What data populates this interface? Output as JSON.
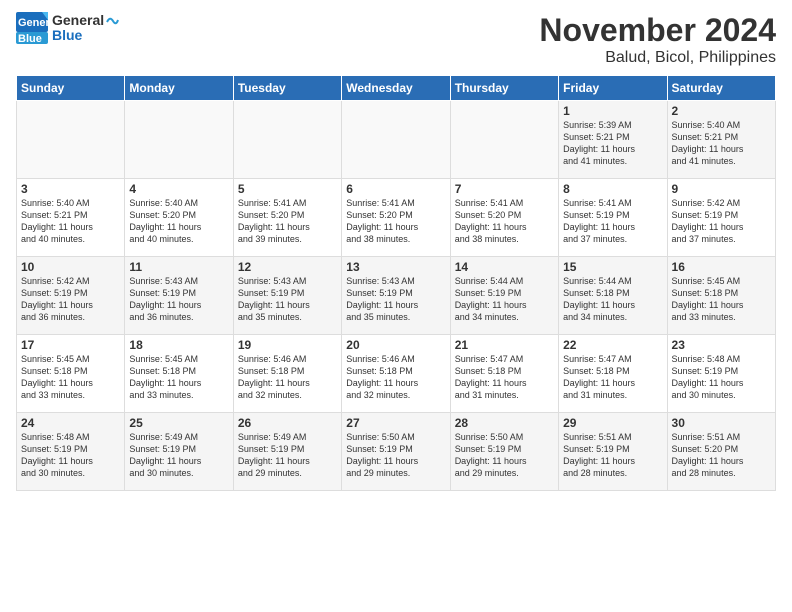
{
  "logo": {
    "text_general": "General",
    "text_blue": "Blue"
  },
  "title": {
    "month": "November 2024",
    "location": "Balud, Bicol, Philippines"
  },
  "weekdays": [
    "Sunday",
    "Monday",
    "Tuesday",
    "Wednesday",
    "Thursday",
    "Friday",
    "Saturday"
  ],
  "weeks": [
    [
      {
        "day": "",
        "info": ""
      },
      {
        "day": "",
        "info": ""
      },
      {
        "day": "",
        "info": ""
      },
      {
        "day": "",
        "info": ""
      },
      {
        "day": "",
        "info": ""
      },
      {
        "day": "1",
        "info": "Sunrise: 5:39 AM\nSunset: 5:21 PM\nDaylight: 11 hours\nand 41 minutes."
      },
      {
        "day": "2",
        "info": "Sunrise: 5:40 AM\nSunset: 5:21 PM\nDaylight: 11 hours\nand 41 minutes."
      }
    ],
    [
      {
        "day": "3",
        "info": "Sunrise: 5:40 AM\nSunset: 5:21 PM\nDaylight: 11 hours\nand 40 minutes."
      },
      {
        "day": "4",
        "info": "Sunrise: 5:40 AM\nSunset: 5:20 PM\nDaylight: 11 hours\nand 40 minutes."
      },
      {
        "day": "5",
        "info": "Sunrise: 5:41 AM\nSunset: 5:20 PM\nDaylight: 11 hours\nand 39 minutes."
      },
      {
        "day": "6",
        "info": "Sunrise: 5:41 AM\nSunset: 5:20 PM\nDaylight: 11 hours\nand 38 minutes."
      },
      {
        "day": "7",
        "info": "Sunrise: 5:41 AM\nSunset: 5:20 PM\nDaylight: 11 hours\nand 38 minutes."
      },
      {
        "day": "8",
        "info": "Sunrise: 5:41 AM\nSunset: 5:19 PM\nDaylight: 11 hours\nand 37 minutes."
      },
      {
        "day": "9",
        "info": "Sunrise: 5:42 AM\nSunset: 5:19 PM\nDaylight: 11 hours\nand 37 minutes."
      }
    ],
    [
      {
        "day": "10",
        "info": "Sunrise: 5:42 AM\nSunset: 5:19 PM\nDaylight: 11 hours\nand 36 minutes."
      },
      {
        "day": "11",
        "info": "Sunrise: 5:43 AM\nSunset: 5:19 PM\nDaylight: 11 hours\nand 36 minutes."
      },
      {
        "day": "12",
        "info": "Sunrise: 5:43 AM\nSunset: 5:19 PM\nDaylight: 11 hours\nand 35 minutes."
      },
      {
        "day": "13",
        "info": "Sunrise: 5:43 AM\nSunset: 5:19 PM\nDaylight: 11 hours\nand 35 minutes."
      },
      {
        "day": "14",
        "info": "Sunrise: 5:44 AM\nSunset: 5:19 PM\nDaylight: 11 hours\nand 34 minutes."
      },
      {
        "day": "15",
        "info": "Sunrise: 5:44 AM\nSunset: 5:18 PM\nDaylight: 11 hours\nand 34 minutes."
      },
      {
        "day": "16",
        "info": "Sunrise: 5:45 AM\nSunset: 5:18 PM\nDaylight: 11 hours\nand 33 minutes."
      }
    ],
    [
      {
        "day": "17",
        "info": "Sunrise: 5:45 AM\nSunset: 5:18 PM\nDaylight: 11 hours\nand 33 minutes."
      },
      {
        "day": "18",
        "info": "Sunrise: 5:45 AM\nSunset: 5:18 PM\nDaylight: 11 hours\nand 33 minutes."
      },
      {
        "day": "19",
        "info": "Sunrise: 5:46 AM\nSunset: 5:18 PM\nDaylight: 11 hours\nand 32 minutes."
      },
      {
        "day": "20",
        "info": "Sunrise: 5:46 AM\nSunset: 5:18 PM\nDaylight: 11 hours\nand 32 minutes."
      },
      {
        "day": "21",
        "info": "Sunrise: 5:47 AM\nSunset: 5:18 PM\nDaylight: 11 hours\nand 31 minutes."
      },
      {
        "day": "22",
        "info": "Sunrise: 5:47 AM\nSunset: 5:18 PM\nDaylight: 11 hours\nand 31 minutes."
      },
      {
        "day": "23",
        "info": "Sunrise: 5:48 AM\nSunset: 5:19 PM\nDaylight: 11 hours\nand 30 minutes."
      }
    ],
    [
      {
        "day": "24",
        "info": "Sunrise: 5:48 AM\nSunset: 5:19 PM\nDaylight: 11 hours\nand 30 minutes."
      },
      {
        "day": "25",
        "info": "Sunrise: 5:49 AM\nSunset: 5:19 PM\nDaylight: 11 hours\nand 30 minutes."
      },
      {
        "day": "26",
        "info": "Sunrise: 5:49 AM\nSunset: 5:19 PM\nDaylight: 11 hours\nand 29 minutes."
      },
      {
        "day": "27",
        "info": "Sunrise: 5:50 AM\nSunset: 5:19 PM\nDaylight: 11 hours\nand 29 minutes."
      },
      {
        "day": "28",
        "info": "Sunrise: 5:50 AM\nSunset: 5:19 PM\nDaylight: 11 hours\nand 29 minutes."
      },
      {
        "day": "29",
        "info": "Sunrise: 5:51 AM\nSunset: 5:19 PM\nDaylight: 11 hours\nand 28 minutes."
      },
      {
        "day": "30",
        "info": "Sunrise: 5:51 AM\nSunset: 5:20 PM\nDaylight: 11 hours\nand 28 minutes."
      }
    ]
  ]
}
